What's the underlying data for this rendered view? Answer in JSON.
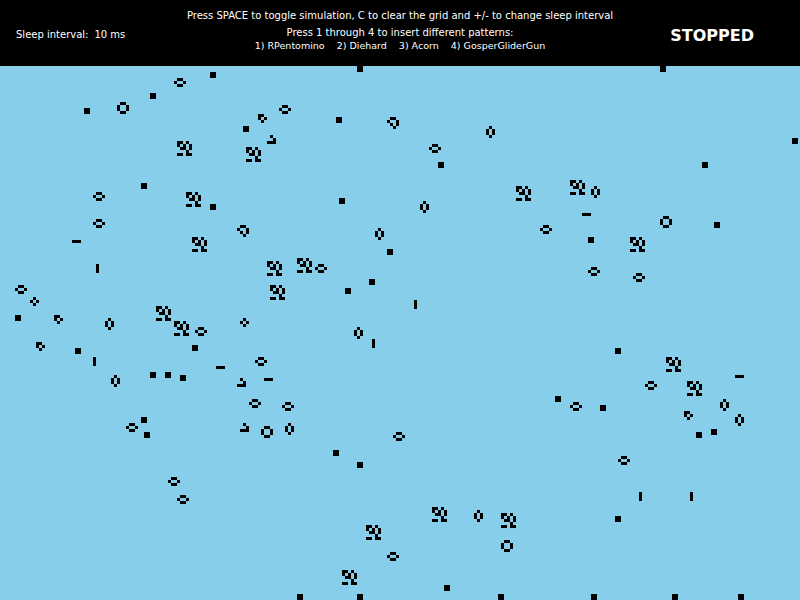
{
  "header": {
    "instructions": "Press SPACE to toggle simulation, C to clear the grid and +/- to change sleep interval",
    "sleep_label": "Sleep interval:",
    "sleep_value": "10 ms",
    "patterns_prompt": "Press 1 through 4 to insert different patterns:",
    "pattern_options": [
      "1) RPentomino",
      "2) Diehard",
      "3) Acorn",
      "4) GosperGliderGun"
    ],
    "status": "STOPPED"
  },
  "board": {
    "patterns": [
      {
        "kind": "block",
        "col": 70,
        "row": 2
      },
      {
        "kind": "beehive_h",
        "col": 58,
        "row": 4
      },
      {
        "kind": "block",
        "col": 50,
        "row": 9
      },
      {
        "kind": "pond",
        "col": 39,
        "row": 12
      },
      {
        "kind": "block",
        "col": 28,
        "row": 14
      },
      {
        "kind": "beehive_h",
        "col": 93,
        "row": 13
      },
      {
        "kind": "block",
        "col": 81,
        "row": 20
      },
      {
        "kind": "boat",
        "col": 86,
        "row": 16
      },
      {
        "kind": "loaf",
        "col": 129,
        "row": 17
      },
      {
        "kind": "beehive_v",
        "col": 162,
        "row": 20
      },
      {
        "kind": "block",
        "col": 112,
        "row": 17
      },
      {
        "kind": "beehive_h",
        "col": 143,
        "row": 26
      },
      {
        "kind": "block",
        "col": 146,
        "row": 32
      },
      {
        "kind": "block",
        "col": 119,
        "row": 0
      },
      {
        "kind": "block",
        "col": 220,
        "row": 0
      },
      {
        "kind": "block",
        "col": 234,
        "row": 32
      },
      {
        "kind": "block",
        "col": 264,
        "row": 24
      },
      {
        "kind": "cluster",
        "col": 59,
        "row": 25
      },
      {
        "kind": "cluster",
        "col": 82,
        "row": 27
      },
      {
        "kind": "glider",
        "col": 89,
        "row": 23
      },
      {
        "kind": "beehive_h",
        "col": 31,
        "row": 42
      },
      {
        "kind": "beehive_h",
        "col": 31,
        "row": 51
      },
      {
        "kind": "block",
        "col": 47,
        "row": 39
      },
      {
        "kind": "block",
        "col": 70,
        "row": 46
      },
      {
        "kind": "cluster",
        "col": 62,
        "row": 42
      },
      {
        "kind": "cluster",
        "col": 64,
        "row": 57
      },
      {
        "kind": "loaf",
        "col": 79,
        "row": 53
      },
      {
        "kind": "beehive_v",
        "col": 140,
        "row": 45
      },
      {
        "kind": "beehive_v",
        "col": 125,
        "row": 54
      },
      {
        "kind": "block",
        "col": 113,
        "row": 44
      },
      {
        "kind": "block",
        "col": 129,
        "row": 61
      },
      {
        "kind": "cluster",
        "col": 172,
        "row": 40
      },
      {
        "kind": "cluster",
        "col": 190,
        "row": 38
      },
      {
        "kind": "beehive_v",
        "col": 197,
        "row": 40
      },
      {
        "kind": "beehive_h",
        "col": 180,
        "row": 53
      },
      {
        "kind": "blinker_h",
        "col": 194,
        "row": 49
      },
      {
        "kind": "block",
        "col": 196,
        "row": 57
      },
      {
        "kind": "pond",
        "col": 220,
        "row": 50
      },
      {
        "kind": "cluster",
        "col": 210,
        "row": 57
      },
      {
        "kind": "block",
        "col": 238,
        "row": 52
      },
      {
        "kind": "beehive_h",
        "col": 196,
        "row": 67
      },
      {
        "kind": "beehive_h",
        "col": 211,
        "row": 69
      },
      {
        "kind": "blinker_v",
        "col": 32,
        "row": 66
      },
      {
        "kind": "blinker_h",
        "col": 24,
        "row": 58
      },
      {
        "kind": "beehive_h",
        "col": 5,
        "row": 73
      },
      {
        "kind": "tub",
        "col": 10,
        "row": 77
      },
      {
        "kind": "block",
        "col": 5,
        "row": 83
      },
      {
        "kind": "boat",
        "col": 18,
        "row": 83
      },
      {
        "kind": "beehive_v",
        "col": 35,
        "row": 84
      },
      {
        "kind": "cluster",
        "col": 89,
        "row": 65
      },
      {
        "kind": "cluster",
        "col": 99,
        "row": 64
      },
      {
        "kind": "beehive_h",
        "col": 105,
        "row": 66
      },
      {
        "kind": "cluster",
        "col": 90,
        "row": 73
      },
      {
        "kind": "block",
        "col": 115,
        "row": 74
      },
      {
        "kind": "block",
        "col": 123,
        "row": 71
      },
      {
        "kind": "blinker_v",
        "col": 138,
        "row": 78
      },
      {
        "kind": "cluster",
        "col": 52,
        "row": 80
      },
      {
        "kind": "cluster",
        "col": 58,
        "row": 85
      },
      {
        "kind": "beehive_h",
        "col": 65,
        "row": 87
      },
      {
        "kind": "tub",
        "col": 80,
        "row": 84
      },
      {
        "kind": "beehive_v",
        "col": 118,
        "row": 87
      },
      {
        "kind": "blinker_v",
        "col": 124,
        "row": 91
      },
      {
        "kind": "block",
        "col": 64,
        "row": 93
      },
      {
        "kind": "boat",
        "col": 12,
        "row": 92
      },
      {
        "kind": "block",
        "col": 25,
        "row": 94
      },
      {
        "kind": "blinker_v",
        "col": 31,
        "row": 97
      },
      {
        "kind": "beehive_v",
        "col": 37,
        "row": 103
      },
      {
        "kind": "block",
        "col": 50,
        "row": 102
      },
      {
        "kind": "block",
        "col": 55,
        "row": 102
      },
      {
        "kind": "block",
        "col": 60,
        "row": 103
      },
      {
        "kind": "blinker_h",
        "col": 72,
        "row": 100
      },
      {
        "kind": "glider",
        "col": 79,
        "row": 104
      },
      {
        "kind": "beehive_h",
        "col": 85,
        "row": 97
      },
      {
        "kind": "blinker_h",
        "col": 88,
        "row": 104
      },
      {
        "kind": "block",
        "col": 205,
        "row": 94
      },
      {
        "kind": "cluster",
        "col": 222,
        "row": 97
      },
      {
        "kind": "cluster",
        "col": 229,
        "row": 105
      },
      {
        "kind": "blinker_h",
        "col": 245,
        "row": 103
      },
      {
        "kind": "beehive_h",
        "col": 83,
        "row": 111
      },
      {
        "kind": "beehive_h",
        "col": 94,
        "row": 112
      },
      {
        "kind": "block",
        "col": 47,
        "row": 117
      },
      {
        "kind": "beehive_h",
        "col": 42,
        "row": 119
      },
      {
        "kind": "block",
        "col": 48,
        "row": 122
      },
      {
        "kind": "glider",
        "col": 80,
        "row": 119
      },
      {
        "kind": "pond",
        "col": 87,
        "row": 120
      },
      {
        "kind": "beehive_v",
        "col": 95,
        "row": 119
      },
      {
        "kind": "beehive_h",
        "col": 131,
        "row": 122
      },
      {
        "kind": "block",
        "col": 185,
        "row": 110
      },
      {
        "kind": "beehive_h",
        "col": 190,
        "row": 112
      },
      {
        "kind": "block",
        "col": 200,
        "row": 113
      },
      {
        "kind": "beehive_h",
        "col": 215,
        "row": 105
      },
      {
        "kind": "beehive_v",
        "col": 240,
        "row": 111
      },
      {
        "kind": "beehive_v",
        "col": 245,
        "row": 116
      },
      {
        "kind": "boat",
        "col": 228,
        "row": 115
      },
      {
        "kind": "block",
        "col": 232,
        "row": 122
      },
      {
        "kind": "block",
        "col": 237,
        "row": 121
      },
      {
        "kind": "block",
        "col": 111,
        "row": 128
      },
      {
        "kind": "block",
        "col": 119,
        "row": 132
      },
      {
        "kind": "beehive_h",
        "col": 206,
        "row": 130
      },
      {
        "kind": "beehive_h",
        "col": 56,
        "row": 137
      },
      {
        "kind": "beehive_h",
        "col": 59,
        "row": 143
      },
      {
        "kind": "blinker_v",
        "col": 213,
        "row": 142
      },
      {
        "kind": "blinker_v",
        "col": 230,
        "row": 142
      },
      {
        "kind": "block",
        "col": 205,
        "row": 150
      },
      {
        "kind": "cluster",
        "col": 122,
        "row": 153
      },
      {
        "kind": "beehive_h",
        "col": 129,
        "row": 162
      },
      {
        "kind": "cluster",
        "col": 114,
        "row": 168
      },
      {
        "kind": "cluster",
        "col": 144,
        "row": 147
      },
      {
        "kind": "beehive_v",
        "col": 158,
        "row": 148
      },
      {
        "kind": "cluster",
        "col": 167,
        "row": 149
      },
      {
        "kind": "pond",
        "col": 167,
        "row": 158
      },
      {
        "kind": "block",
        "col": 99,
        "row": 176
      },
      {
        "kind": "block",
        "col": 119,
        "row": 176
      },
      {
        "kind": "block",
        "col": 166,
        "row": 176
      },
      {
        "kind": "block",
        "col": 197,
        "row": 176
      },
      {
        "kind": "block",
        "col": 224,
        "row": 176
      },
      {
        "kind": "block",
        "col": 246,
        "row": 176
      },
      {
        "kind": "block",
        "col": 148,
        "row": 173
      }
    ]
  }
}
